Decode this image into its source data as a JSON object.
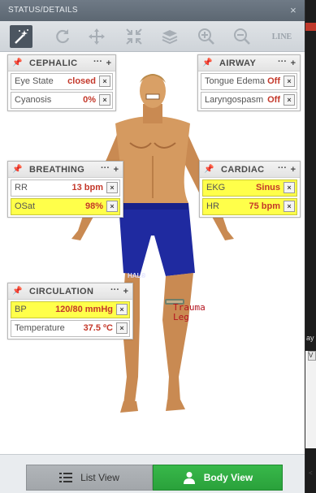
{
  "window": {
    "title": "STATUS/DETAILS",
    "close": "×"
  },
  "toolbar": {
    "line_label": "LINE"
  },
  "panels": {
    "cephalic": {
      "title": "CEPHALIC",
      "more": "···",
      "add": "+",
      "rows": [
        {
          "label": "Eye State",
          "value": "closed"
        },
        {
          "label": "Cyanosis",
          "value": "0%"
        }
      ]
    },
    "airway": {
      "title": "AIRWAY",
      "more": "···",
      "add": "+",
      "rows": [
        {
          "label": "Tongue Edema",
          "value": "Off"
        },
        {
          "label": "Laryngospasm",
          "value": "Off"
        }
      ]
    },
    "breathing": {
      "title": "BREATHING",
      "more": "···",
      "add": "+",
      "rows": [
        {
          "label": "RR",
          "value": "13 bpm"
        },
        {
          "label": "OSat",
          "value": "98%"
        }
      ]
    },
    "cardiac": {
      "title": "CARDIAC",
      "more": "···",
      "add": "+",
      "rows": [
        {
          "label": "EKG",
          "value": "Sinus"
        },
        {
          "label": "HR",
          "value": "75 bpm"
        }
      ]
    },
    "circulation": {
      "title": "CIRCULATION",
      "more": "···",
      "add": "+",
      "rows": [
        {
          "label": "BP",
          "value": "120/80 mmHg"
        },
        {
          "label": "Temperature",
          "value": "37.5 ºC"
        }
      ]
    }
  },
  "row_close": "×",
  "figure": {
    "brand_label": "HAL®",
    "trauma_label_line1": "Trauma",
    "trauma_label_line2": "Leg"
  },
  "view_buttons": {
    "list_label": "List View",
    "body_label": "Body View"
  },
  "side_fragments": {
    "text": "ay",
    "tab": "V",
    "scroll": "<"
  },
  "colors": {
    "highlight": "#ffff4a",
    "value_red": "#c4382a",
    "body_view_green": "#2eaa40",
    "trauma_red": "#b4141f"
  }
}
